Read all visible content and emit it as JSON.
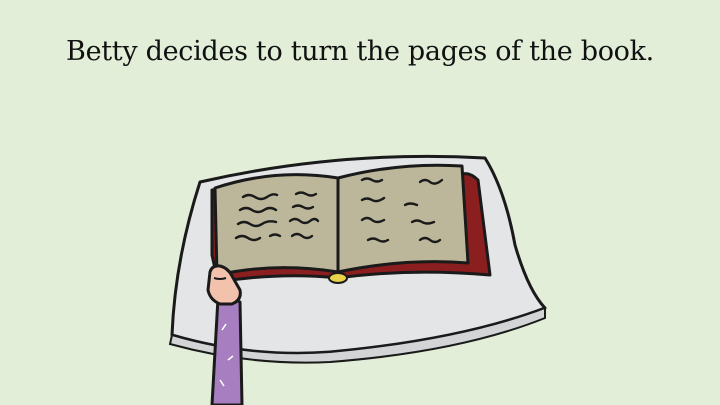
{
  "slide": {
    "caption": "Betty decides to turn the pages of the book.",
    "illustration": {
      "subject-icon": "open-book-on-stand-icon",
      "hand-icon": "reaching-hand-icon"
    }
  },
  "colors": {
    "background": "#e2eed8",
    "stand": "#e4e5e7",
    "page": "#bcb79a",
    "book-cover": "#8b1f1f",
    "sleeve": "#a77fc0",
    "skin": "#f2c2ad"
  }
}
